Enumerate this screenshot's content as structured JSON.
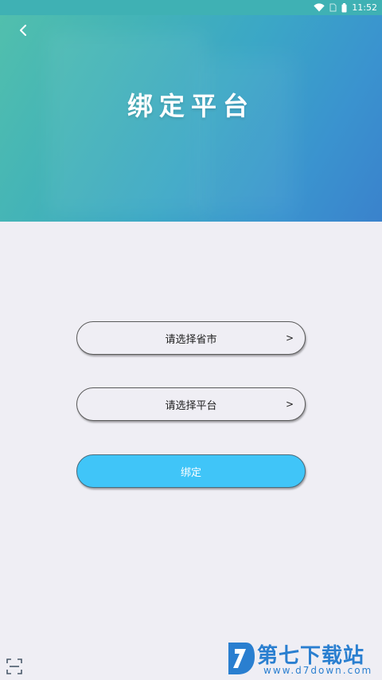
{
  "status_bar": {
    "time": "11:52"
  },
  "header": {
    "title": "绑定平台",
    "back_icon": "chevron-left-icon"
  },
  "form": {
    "province_select": {
      "label": "请选择省市",
      "arrow": ">"
    },
    "platform_select": {
      "label": "请选择平台",
      "arrow": ">"
    },
    "bind_button": {
      "label": "绑定"
    }
  },
  "footer": {
    "scan_icon": "scan-icon"
  },
  "watermark": {
    "text": "第七下载站",
    "url": "www.d7down.com"
  },
  "colors": {
    "primary_button": "#40c5f8",
    "page_background": "#efeef4",
    "header_gradient_start": "#52c0ac",
    "header_gradient_end": "#3a82cc"
  }
}
